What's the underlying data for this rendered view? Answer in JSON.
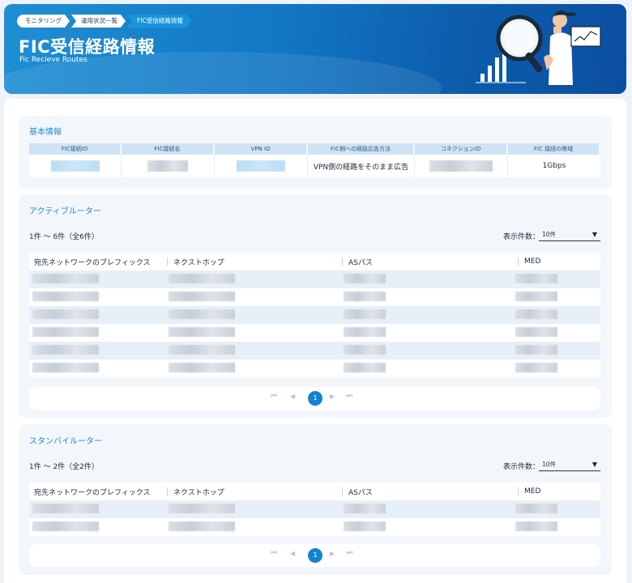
{
  "breadcrumb": [
    "モニタリング",
    "運用状況一覧",
    "FIC受信経路情報"
  ],
  "header": {
    "title": "FIC受信経路情報",
    "subtitle": "Fic Recieve Routes"
  },
  "basic_info": {
    "title": "基本情報",
    "columns": [
      "FIC接続ID",
      "FIC接続名",
      "VPN ID",
      "FIC側への経路広告方法",
      "コネクションID",
      "FIC 接続の帯域"
    ],
    "values": {
      "route_advertise": "VPN側の経路をそのまま広告",
      "bandwidth": "1Gbps"
    }
  },
  "active_router": {
    "title": "アクティブルーター",
    "count_text": "1件 ～ 6件（全6件）",
    "per_page_label": "表示件数：",
    "per_page_value": "10件",
    "columns": [
      "宛先ネットワークのプレフィックス",
      "ネクストホップ",
      "ASパス",
      "MED"
    ],
    "current_page": "1"
  },
  "standby_router": {
    "title": "スタンバイルーター",
    "count_text": "1件 ～ 2件（全2件）",
    "per_page_label": "表示件数：",
    "per_page_value": "10件",
    "columns": [
      "宛先ネットワークのプレフィックス",
      "ネクストホップ",
      "ASパス",
      "MED"
    ],
    "current_page": "1"
  },
  "icons": [
    "magnifier-illustration",
    "first-page-icon",
    "prev-page-icon",
    "next-page-icon",
    "last-page-icon",
    "caret-down-icon"
  ]
}
